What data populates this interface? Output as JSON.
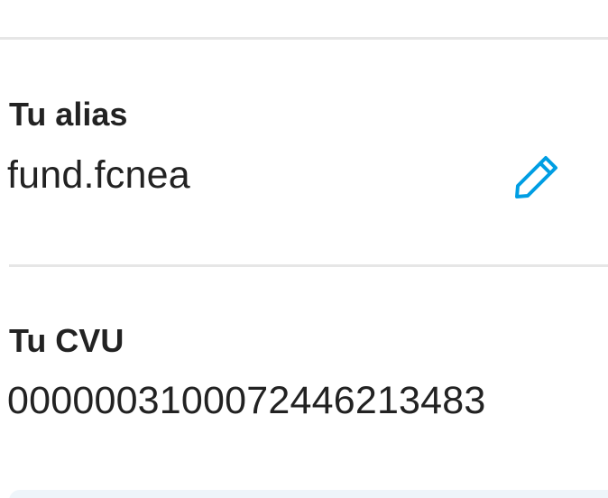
{
  "alias": {
    "label": "Tu alias",
    "value": "fund.fcnea",
    "edit_icon": "pencil-icon",
    "accent_color": "#009ee3"
  },
  "cvu": {
    "label": "Tu CVU",
    "value": "0000003100072446213483"
  }
}
